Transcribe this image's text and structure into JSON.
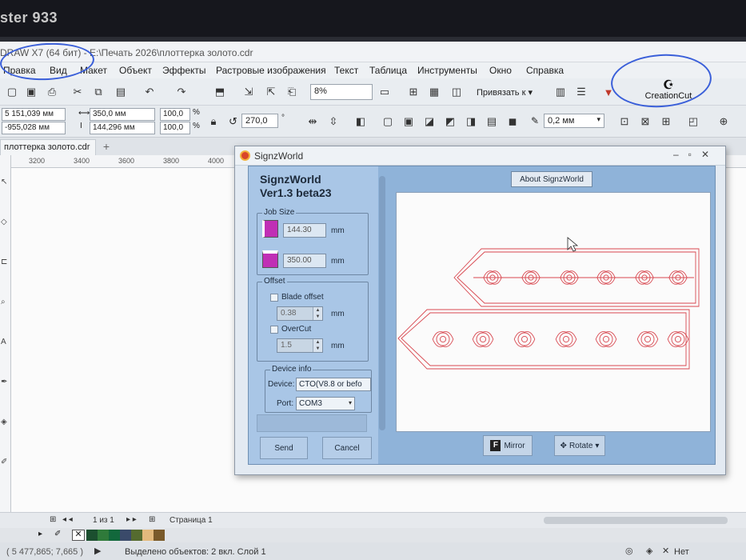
{
  "os": {
    "wallpaper_text": "ster 933"
  },
  "app": {
    "title_prefix": "DRAW X7 (64 бит) - ",
    "file_path": "E:\\Печать 2026\\плоттерка золото.cdr",
    "menu": [
      "Правка",
      "Вид",
      "Макет",
      "Объект",
      "Эффекты",
      "Растровые изображения",
      "Текст",
      "Таблица",
      "Инструменты",
      "Окно",
      "Справка"
    ],
    "toolbar": {
      "zoom": "8%",
      "snap_label": "Привязать к",
      "plugin_label": "CreationCut"
    },
    "property_bar": {
      "x": "5 151,039 мм",
      "y": "-955,028 мм",
      "width": "350,0 мм",
      "height": "144,296 мм",
      "scale_x": "100,0",
      "scale_y": "100,0",
      "percent": "%",
      "angle": "270,0",
      "degree": "°",
      "outline": "0,2 мм"
    },
    "doc_tab": "плоттерка золото.cdr",
    "ruler_ticks": [
      "3200",
      "3400",
      "3600",
      "3800",
      "4000"
    ],
    "page_nav": {
      "pages": "1 из 1",
      "page_name": "Страница 1"
    },
    "status": {
      "coords": "( 5 477,865; 7,665 )",
      "selection": "Выделено объектов: 2 вкл. Слой 1",
      "fill_none": "Нет"
    },
    "palette": [
      "#1b4f2f",
      "#2f7a3a",
      "#12683c",
      "#3a4a6a",
      "#556b2f",
      "#e3b97c",
      "#7a5a2a"
    ]
  },
  "dialog": {
    "title": "SignzWorld",
    "app_name": "SignzWorld",
    "version": "Ver1.3 beta23",
    "job_size": {
      "label": "Job Size",
      "height": "144.30",
      "width": "350.00",
      "unit": "mm"
    },
    "offset": {
      "label": "Offset",
      "blade_label": "Blade offset",
      "blade_value": "0.38",
      "overcut_label": "OverCut",
      "overcut_value": "1.5",
      "unit": "mm"
    },
    "device": {
      "label": "Device info",
      "device_label": "Device:",
      "device_value": "CTO(V8.8 or befo",
      "port_label": "Port:",
      "port_value": "COM3"
    },
    "buttons": {
      "send": "Send",
      "cancel": "Cancel",
      "about": "About SignzWorld",
      "mirror": "Mirror",
      "rotate": "Rotate"
    },
    "preview_stroke": "#d8474f"
  }
}
